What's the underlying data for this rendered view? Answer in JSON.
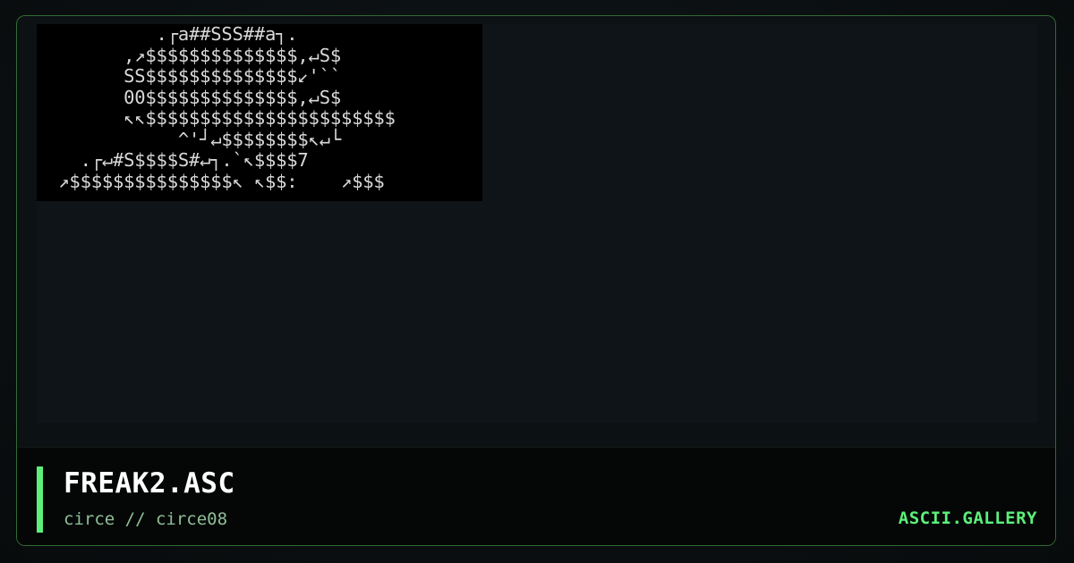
{
  "art": {
    "lines": [
      "           .┌a##SSS##a┐.",
      "        ,↗$$$$$$$$$$$$$$,↵S$",
      "        SS$$$$$$$$$$$$$$↙'``",
      "        00$$$$$$$$$$$$$$,↵S$",
      "        ↖↖$$$$$$$$$$$$$$$$$$$$$$$",
      "             ^'┘↵$$$$$$$$↖↵└",
      "    .┌↵#S$$$$S#↵┐.`↖$$$$7",
      "  ↗$$$$$$$$$$$$$$$↖ ↖$$:    ↗$$$"
    ]
  },
  "footer": {
    "title": "FREAK2.ASC",
    "byline": "circe // circe08",
    "brand": "ASCII.GALLERY"
  },
  "colors": {
    "accent": "#5cf07a",
    "frame_border": "#2f6b32",
    "art_text": "#d9d9d9",
    "art_bg": "#000000"
  }
}
